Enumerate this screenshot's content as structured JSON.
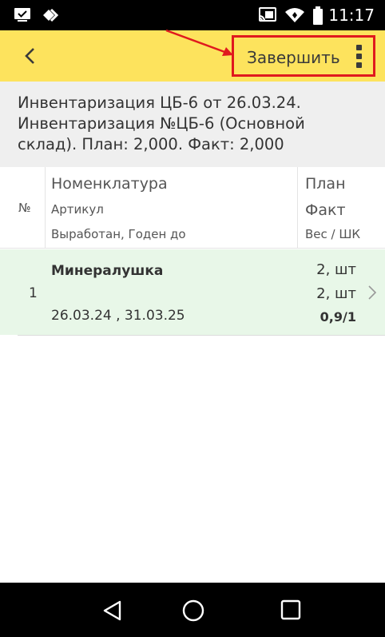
{
  "status_bar": {
    "time": "11:17",
    "left_icons": [
      "screen-check-icon",
      "diamond-arrows-icon"
    ],
    "right_icons": [
      "cast-icon",
      "wifi-icon",
      "battery-icon"
    ]
  },
  "toolbar": {
    "back_icon": "chevron-left-icon",
    "finish_label": "Завершить",
    "menu_icon": "more-vertical-icon",
    "accent_color": "#fde35d",
    "highlight_color": "#e0191e"
  },
  "document": {
    "line1": "Инвентаризация ЦБ-6 от 26.03.24.",
    "line2": "Инвентаризация №ЦБ-6 (Основной",
    "line3": "склад). План: 2,000. Факт: 2,000"
  },
  "table": {
    "headers": {
      "num": "№",
      "name": "Номенклатура",
      "article": "Артикул",
      "dates": "Выработан, Годен до",
      "plan": "План",
      "fact": "Факт",
      "weight": "Вес / ШК"
    },
    "rows": [
      {
        "num": "1",
        "name": "Минералушка",
        "dates": "26.03.24 , 31.03.25",
        "plan": "2, шт",
        "fact": "2, шт",
        "weight": "0,9/1",
        "row_color": "#e8f7e8"
      }
    ]
  },
  "nav_bar": {
    "icons": [
      "back-triangle-icon",
      "home-circle-icon",
      "recents-square-icon"
    ]
  }
}
